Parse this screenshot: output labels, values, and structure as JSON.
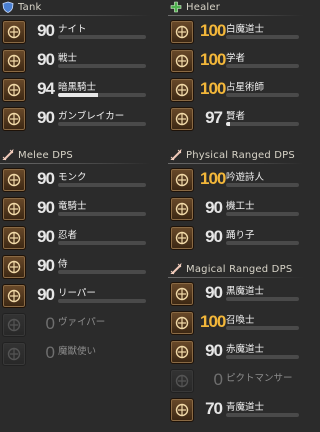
{
  "sections": {
    "tank": {
      "title": "Tank",
      "icon": "shield-icon",
      "color": "#4a7fd1",
      "jobs": [
        {
          "name": "ナイト",
          "level": "90",
          "exp": 0.0,
          "icon": "paladin-icon",
          "state": "normal"
        },
        {
          "name": "戦士",
          "level": "90",
          "exp": 0.0,
          "icon": "warrior-icon",
          "state": "normal"
        },
        {
          "name": "暗黒騎士",
          "level": "94",
          "exp": 0.45,
          "icon": "dark-knight-icon",
          "state": "normal"
        },
        {
          "name": "ガンブレイカー",
          "level": "90",
          "exp": 0.0,
          "icon": "gunbreaker-icon",
          "state": "normal"
        }
      ]
    },
    "healer": {
      "title": "Healer",
      "icon": "cross-icon",
      "color": "#4fb04f",
      "jobs": [
        {
          "name": "白魔道士",
          "level": "100",
          "exp": 0.0,
          "icon": "white-mage-icon",
          "state": "max"
        },
        {
          "name": "学者",
          "level": "100",
          "exp": 0.0,
          "icon": "scholar-icon",
          "state": "max"
        },
        {
          "name": "占星術師",
          "level": "100",
          "exp": 0.0,
          "icon": "astrologian-icon",
          "state": "max"
        },
        {
          "name": "賢者",
          "level": "97",
          "exp": 0.05,
          "icon": "sage-icon",
          "state": "normal"
        }
      ]
    },
    "melee": {
      "title": "Melee DPS",
      "icon": "sword-icon",
      "color": "#d16a4a",
      "jobs": [
        {
          "name": "モンク",
          "level": "90",
          "exp": 0.0,
          "icon": "monk-icon",
          "state": "normal"
        },
        {
          "name": "竜騎士",
          "level": "90",
          "exp": 0.0,
          "icon": "dragoon-icon",
          "state": "normal"
        },
        {
          "name": "忍者",
          "level": "90",
          "exp": 0.0,
          "icon": "ninja-icon",
          "state": "normal"
        },
        {
          "name": "侍",
          "level": "90",
          "exp": 0.0,
          "icon": "samurai-icon",
          "state": "normal"
        },
        {
          "name": "リーパー",
          "level": "90",
          "exp": 0.0,
          "icon": "reaper-icon",
          "state": "normal"
        },
        {
          "name": "ヴァイパー",
          "level": "0",
          "exp": 0.0,
          "icon": "viper-icon",
          "state": "locked"
        },
        {
          "name": "魔獣使い",
          "level": "0",
          "exp": 0.0,
          "icon": "beastmaster-icon",
          "state": "locked"
        }
      ]
    },
    "ranged": {
      "title": "Physical Ranged DPS",
      "icon": "bow-icon",
      "color": "#d16a4a",
      "jobs": [
        {
          "name": "吟遊詩人",
          "level": "100",
          "exp": 0.0,
          "icon": "bard-icon",
          "state": "max"
        },
        {
          "name": "機工士",
          "level": "90",
          "exp": 0.0,
          "icon": "machinist-icon",
          "state": "normal"
        },
        {
          "name": "踊り子",
          "level": "90",
          "exp": 0.0,
          "icon": "dancer-icon",
          "state": "normal"
        }
      ]
    },
    "magical": {
      "title": "Magical Ranged DPS",
      "icon": "wand-icon",
      "color": "#d16a4a",
      "jobs": [
        {
          "name": "黒魔道士",
          "level": "90",
          "exp": 0.0,
          "icon": "black-mage-icon",
          "state": "normal"
        },
        {
          "name": "召喚士",
          "level": "100",
          "exp": 0.0,
          "icon": "summoner-icon",
          "state": "max"
        },
        {
          "name": "赤魔道士",
          "level": "90",
          "exp": 0.0,
          "icon": "red-mage-icon",
          "state": "normal"
        },
        {
          "name": "ピクトマンサー",
          "level": "0",
          "exp": 0.0,
          "icon": "pictomancer-icon",
          "state": "locked"
        },
        {
          "name": "青魔道士",
          "level": "70",
          "exp": 0.0,
          "icon": "blue-mage-icon",
          "state": "normal"
        }
      ]
    }
  }
}
